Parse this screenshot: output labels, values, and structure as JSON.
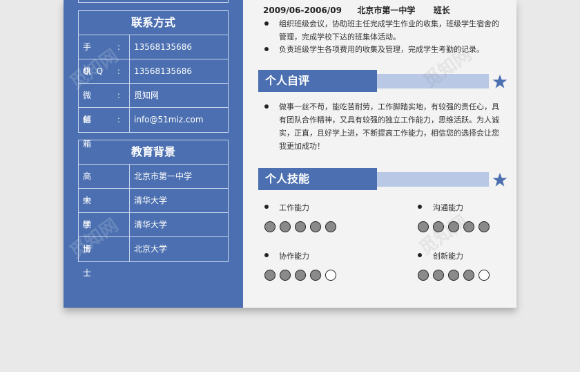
{
  "contact": {
    "heading": "联系方式",
    "rows": [
      {
        "key": "手机",
        "colon": ":",
        "value": "13568135686"
      },
      {
        "key": "QQ",
        "colon": ":",
        "value": "13568135686"
      },
      {
        "key": "微信",
        "colon": ":",
        "value": "觅知网"
      },
      {
        "key": "邮箱",
        "colon": ":",
        "value": "info@51miz.com"
      }
    ]
  },
  "education": {
    "heading": "教育背景",
    "rows": [
      {
        "key": "高中",
        "value": "北京市第一中学"
      },
      {
        "key": "大学",
        "value": "清华大学"
      },
      {
        "key": "硕士",
        "value": "清华大学"
      },
      {
        "key": "博士",
        "value": "北京大学"
      }
    ]
  },
  "experience": {
    "date": "2009/06-2006/09",
    "org": "北京市第一中学",
    "role": "班长",
    "bullets": [
      "组织班级会议，协助班主任完成学生作业的收集，班级学生宿舍的管理，完成学校下达的班集体活动。",
      "负责班级学生各项费用的收集及管理，完成学生考勤的记录。"
    ]
  },
  "self_eval": {
    "title": "个人自评",
    "text": "做事一丝不苟，能吃苦耐劳，工作脚踏实地，有较强的责任心，具有团队合作精神，又具有较强的独立工作能力，思维活跃。为人诚实，正直，且好学上进，不断提高工作能力，相信您的选择会让您我更加成功！"
  },
  "skills": {
    "title": "个人技能",
    "items": [
      {
        "label": "工作能力",
        "filled": 5,
        "total": 5
      },
      {
        "label": "沟通能力",
        "filled": 5,
        "total": 5
      },
      {
        "label": "协作能力",
        "filled": 4,
        "total": 5
      },
      {
        "label": "创新能力",
        "filled": 4,
        "total": 5
      }
    ]
  },
  "watermark": "觅知网",
  "colors": {
    "accent": "#4b6fb0",
    "accent_light": "#b9c8e5",
    "circle_fill": "#8a8a8a"
  }
}
